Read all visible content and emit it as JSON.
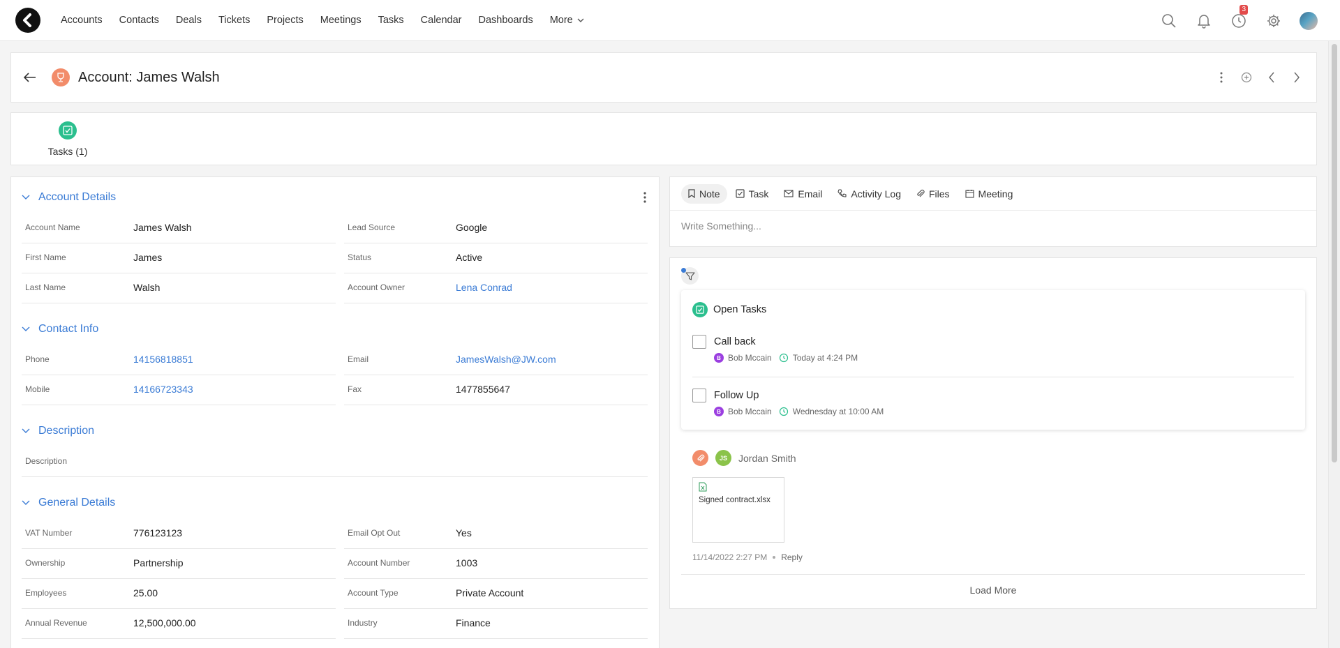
{
  "nav": {
    "items": [
      "Accounts",
      "Contacts",
      "Deals",
      "Tickets",
      "Projects",
      "Meetings",
      "Tasks",
      "Calendar",
      "Dashboards"
    ],
    "more_label": "More",
    "reminder_count": "3"
  },
  "header": {
    "title": "Account: James Walsh"
  },
  "related": {
    "tasks_label": "Tasks (1)"
  },
  "details": {
    "sections": {
      "account_details": "Account Details",
      "contact_info": "Contact Info",
      "description": "Description",
      "general_details": "General Details"
    },
    "account_details": {
      "left": [
        {
          "label": "Account Name",
          "value": "James Walsh"
        },
        {
          "label": "First Name",
          "value": "James"
        },
        {
          "label": "Last Name",
          "value": "Walsh"
        }
      ],
      "right": [
        {
          "label": "Lead Source",
          "value": "Google"
        },
        {
          "label": "Status",
          "value": "Active"
        },
        {
          "label": "Account Owner",
          "value": "Lena Conrad"
        }
      ]
    },
    "contact_info": {
      "left": [
        {
          "label": "Phone",
          "value": "14156818851"
        },
        {
          "label": "Mobile",
          "value": "14166723343"
        }
      ],
      "right": [
        {
          "label": "Email",
          "value": "JamesWalsh@JW.com"
        },
        {
          "label": "Fax",
          "value": "1477855647"
        }
      ]
    },
    "description": {
      "label": "Description",
      "value": ""
    },
    "general_details": {
      "left": [
        {
          "label": "VAT Number",
          "value": "776123123"
        },
        {
          "label": "Ownership",
          "value": "Partnership"
        },
        {
          "label": "Employees",
          "value": "25.00"
        },
        {
          "label": "Annual Revenue",
          "value": "12,500,000.00"
        }
      ],
      "right": [
        {
          "label": "Email Opt Out",
          "value": "Yes"
        },
        {
          "label": "Account Number",
          "value": "1003"
        },
        {
          "label": "Account Type",
          "value": "Private Account"
        },
        {
          "label": "Industry",
          "value": "Finance"
        }
      ]
    }
  },
  "composer": {
    "tabs": [
      "Note",
      "Task",
      "Email",
      "Activity Log",
      "Files",
      "Meeting"
    ],
    "placeholder": "Write Something..."
  },
  "feed": {
    "open_tasks_title": "Open Tasks",
    "tasks": [
      {
        "title": "Call back",
        "owner_initial": "B",
        "owner": "Bob Mccain",
        "due": "Today at 4:24 PM"
      },
      {
        "title": "Follow Up",
        "owner_initial": "B",
        "owner": "Bob Mccain",
        "due": "Wednesday at 10:00 AM"
      }
    ],
    "activity": {
      "user_initials": "JS",
      "user_name": "Jordan Smith",
      "file_name": "Signed contract.xlsx",
      "timestamp": "11/14/2022 2:27 PM",
      "reply_label": "Reply"
    },
    "load_more": "Load More"
  },
  "colors": {
    "accent": "#3a7bd5",
    "task_green": "#2bbf8e",
    "account_orange": "#f28c6a",
    "badge_red": "#e34b4b"
  }
}
